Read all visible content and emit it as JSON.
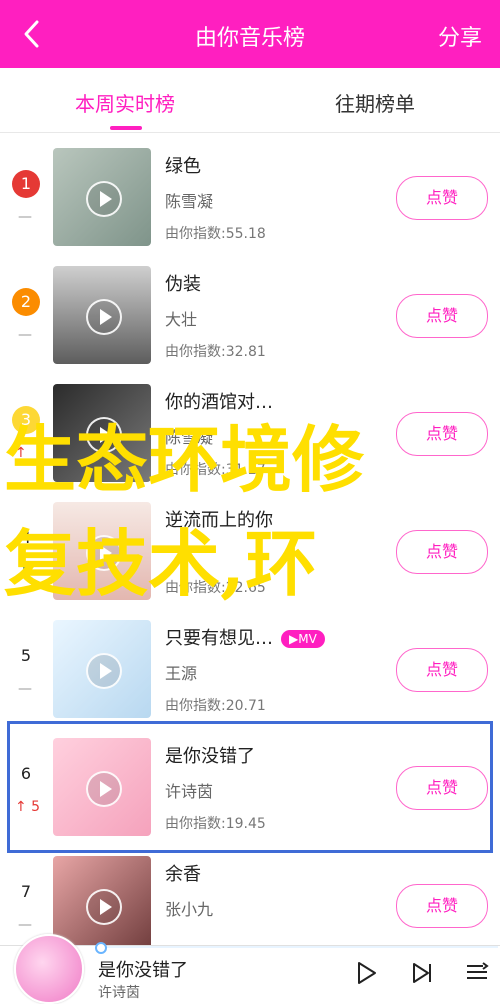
{
  "header": {
    "title": "由你音乐榜",
    "share_label": "分享"
  },
  "tabs": [
    {
      "label": "本周实时榜",
      "active": true
    },
    {
      "label": "往期榜单",
      "active": false
    }
  ],
  "list": [
    {
      "rank": "1",
      "song": "绿色",
      "artist": "陈雪凝",
      "index": "由你指数:55.18",
      "like_label": "点赞",
      "trend": "—"
    },
    {
      "rank": "2",
      "song": "伪装",
      "artist": "大壮",
      "index": "由你指数:32.81",
      "like_label": "点赞",
      "trend": "—"
    },
    {
      "rank": "3",
      "song": "你的酒馆对…",
      "artist": "陈雪凝",
      "index": "由你指数:31.27",
      "like_label": "点赞",
      "trend": "↑"
    },
    {
      "rank": "4",
      "song": "逆流而上的你",
      "artist": "",
      "index": "由你指数:22.65",
      "like_label": "点赞",
      "trend": "↓"
    },
    {
      "rank": "5",
      "song": "只要有想见…",
      "artist": "王源",
      "index": "由你指数:20.71",
      "like_label": "点赞",
      "trend": "—",
      "badge": "▶MV"
    },
    {
      "rank": "6",
      "song": "是你没错了",
      "artist": "许诗茵",
      "index": "由你指数:19.45",
      "like_label": "点赞",
      "trend": "↑ 5"
    },
    {
      "rank": "7",
      "song": "余香",
      "artist": "张小九",
      "index": "",
      "like_label": "点赞",
      "trend": "—"
    }
  ],
  "overlay_text": [
    "生态环境修",
    "复技术,环"
  ],
  "player": {
    "title": "是你没错了",
    "artist": "许诗茵"
  },
  "colors": {
    "accent": "#ff1fc0",
    "highlight_border": "#3f6bd6",
    "overlay": "#ffdf00"
  },
  "icons": [
    "back-arrow-icon",
    "play-icon",
    "next-icon",
    "playlist-icon"
  ]
}
